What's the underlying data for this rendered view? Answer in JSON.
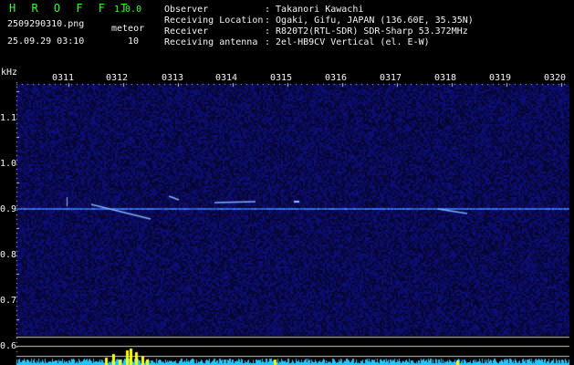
{
  "app": {
    "title": "H R O F F T",
    "version": "1.0.0",
    "filename": "2509290310.png",
    "datetime": "25.09.29 03:10",
    "meteor_label": "meteor",
    "meteor_count": "10"
  },
  "info": {
    "observer_label": "Observer",
    "observer_value": ": Takanori Kawachi",
    "location_label": "Receiving Location",
    "location_value": ": Ogaki, Gifu, JAPAN (136.60E, 35.35N)",
    "receiver_label": "Receiver",
    "receiver_value": ": R820T2(RTL-SDR) SDR-Sharp 53.372MHz",
    "antenna_label": "Receiving antenna",
    "antenna_value": ": 2el-HB9CV Vertical (el. E-W)"
  },
  "axis": {
    "unit": "kHz",
    "time_ticks": [
      "0311",
      "0312",
      "0313",
      "0314",
      "0315",
      "0316",
      "0317",
      "0318",
      "0319",
      "0320"
    ],
    "freq_ticks": [
      "1.1",
      "1.0",
      "0.9",
      "0.8",
      "0.7",
      "0.6"
    ]
  },
  "colors": {
    "background": "#000000",
    "noise": "#101070",
    "signal_line": "#4080ff",
    "spectrum": "#22c6ff",
    "spike": "#ffff00",
    "header_green": "#33ff33"
  }
}
